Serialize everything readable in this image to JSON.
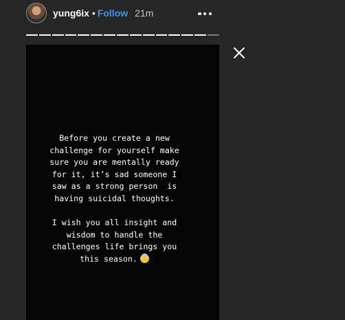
{
  "header": {
    "username": "yung6ix",
    "separator": "•",
    "follow_label": "Follow",
    "time": "21m"
  },
  "progress": {
    "segments_total": 15,
    "current_segment": 14
  },
  "story": {
    "text": "Before you create a new\nchallenge for yourself make\nsure you are mentally ready\nfor it, it’s sad someone I\nsaw as a strong person  is\nhaving suicidal thoughts.\n\nI wish you all insight and\nwisdom to handle the\nchallenges life brings you\nthis season.",
    "emoji": "face-with-halo-icon"
  },
  "icons": {
    "more": "more-horizontal-icon",
    "close": "close-icon"
  },
  "colors": {
    "background": "#262626",
    "story_background": "#050505",
    "follow": "#3897f0",
    "text": "#ffffff"
  }
}
